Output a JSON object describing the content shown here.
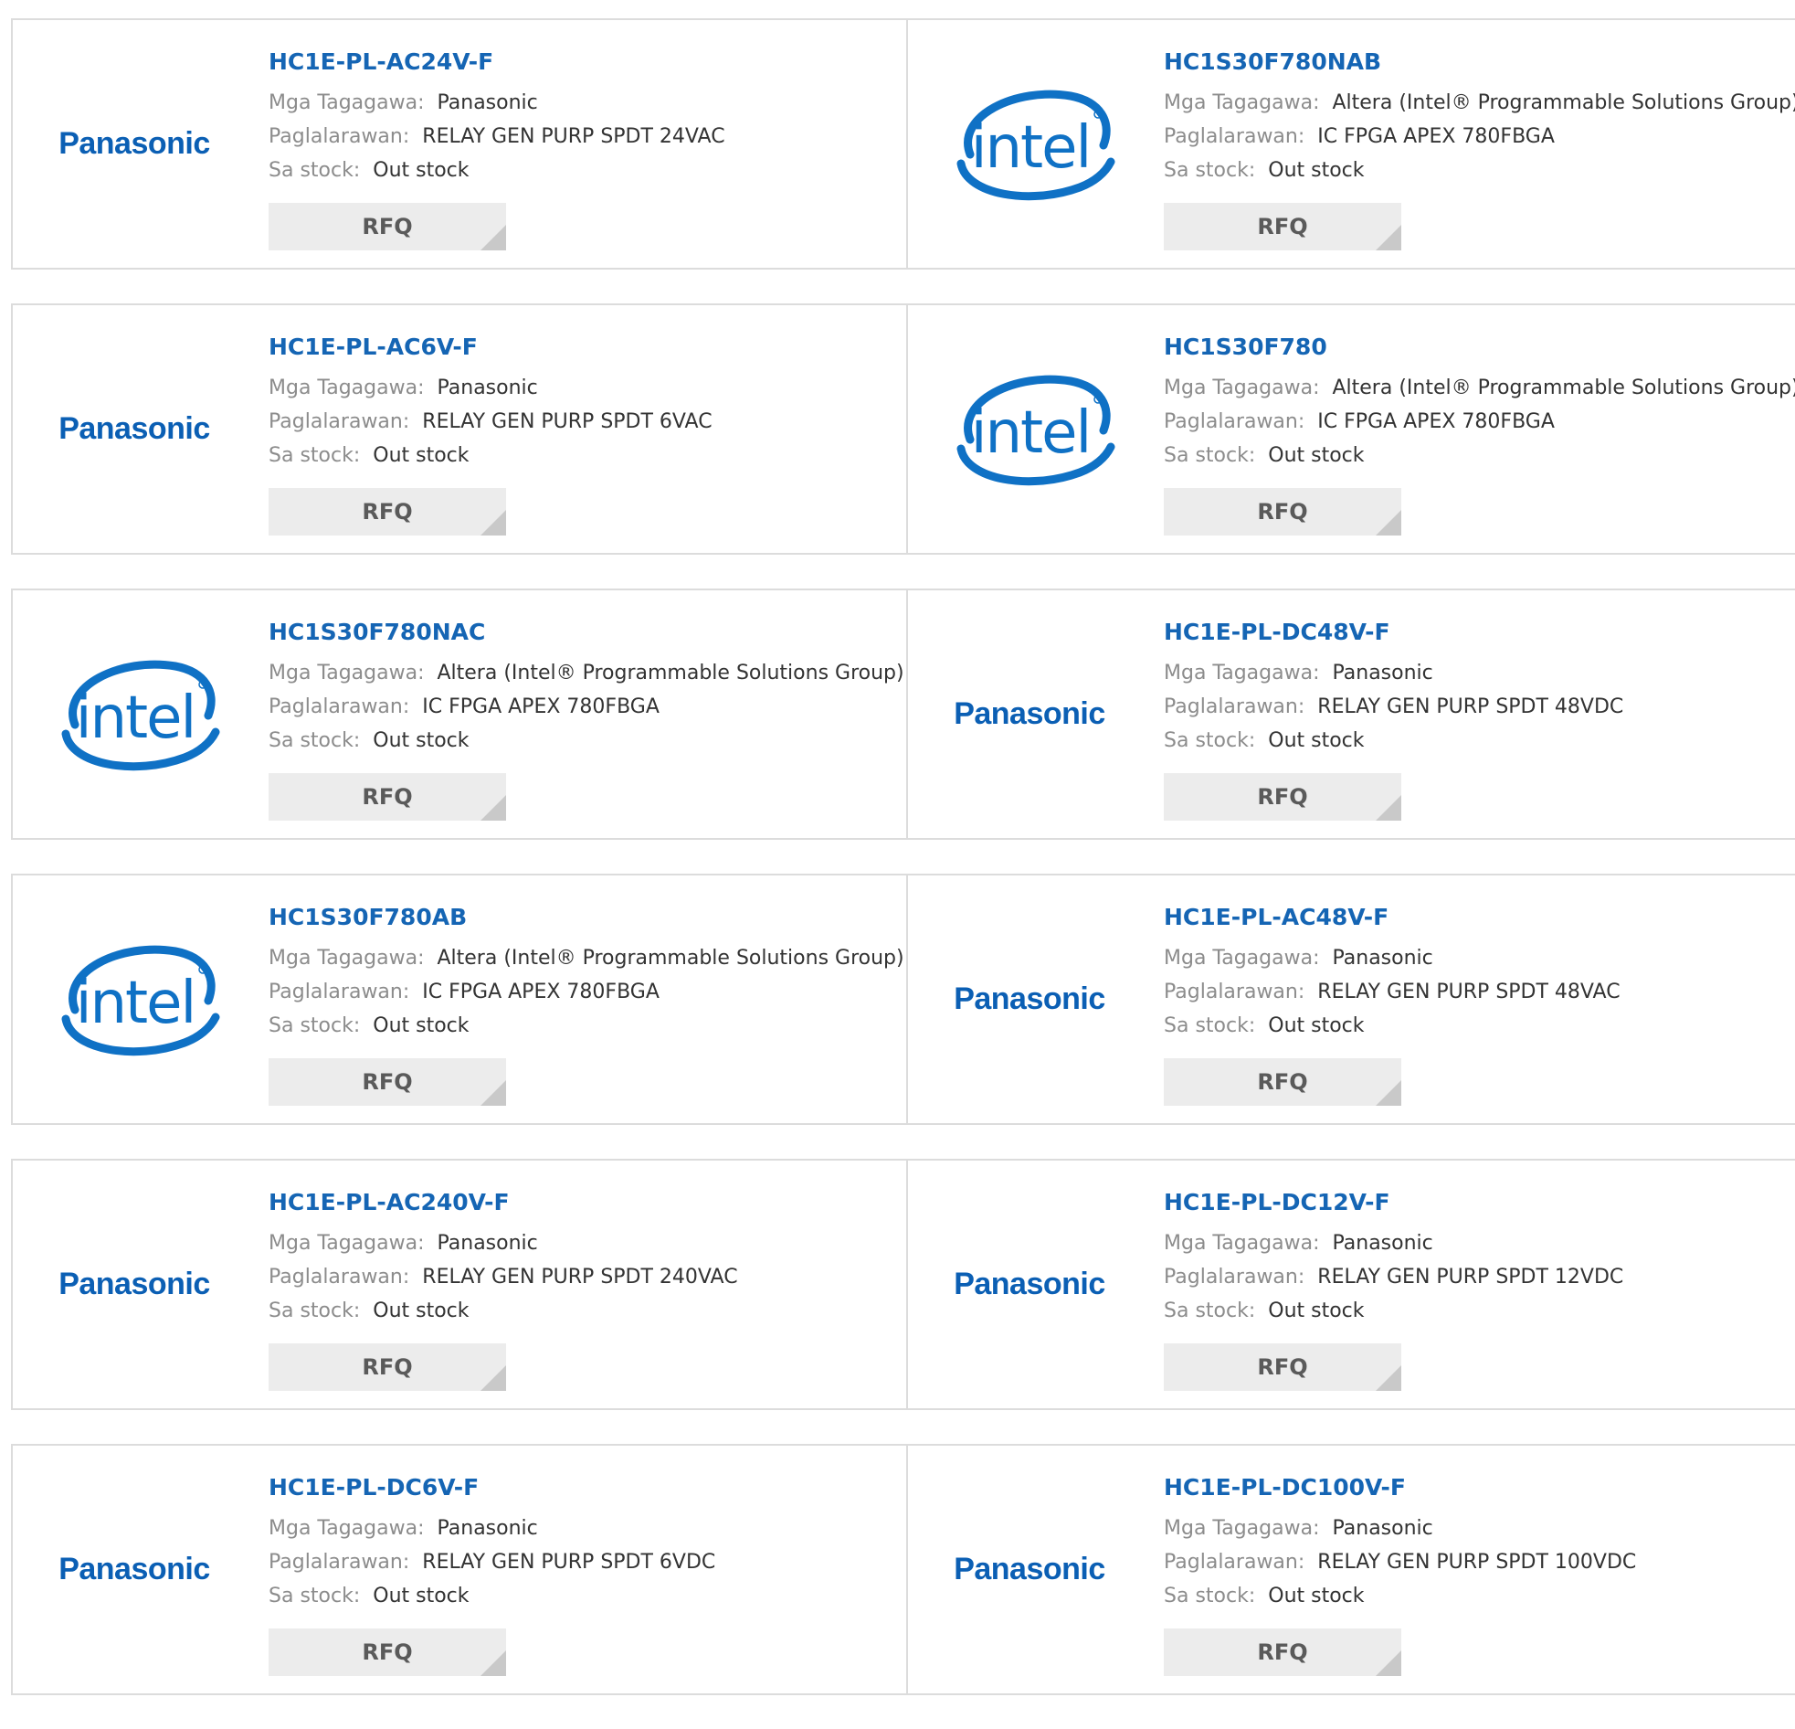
{
  "labels": {
    "manufacturer": "Mga Tagagawa:",
    "description": "Paglalarawan:",
    "stock": "Sa stock:",
    "rfq": "RFQ"
  },
  "brand_colors": {
    "panasonic": "#0b5fb4",
    "intel": "#0f71c5",
    "link": "#1565b4"
  },
  "logos": {
    "panasonic": {
      "text": "Panasonic",
      "icon": "panasonic-logo"
    },
    "intel": {
      "text": "intel",
      "icon": "intel-logo"
    }
  },
  "products": [
    {
      "part": "HC1E-PL-AC24V-F",
      "logo": "panasonic",
      "manufacturer": "Panasonic",
      "description": "RELAY GEN PURP SPDT 24VAC",
      "stock": "Out stock"
    },
    {
      "part": "HC1S30F780NAB",
      "logo": "intel",
      "manufacturer": "Altera (Intel® Programmable Solutions Group)",
      "description": "IC FPGA APEX 780FBGA",
      "stock": "Out stock"
    },
    {
      "part": "HC1E-PL-AC6V-F",
      "logo": "panasonic",
      "manufacturer": "Panasonic",
      "description": "RELAY GEN PURP SPDT 6VAC",
      "stock": "Out stock"
    },
    {
      "part": "HC1S30F780",
      "logo": "intel",
      "manufacturer": "Altera (Intel® Programmable Solutions Group)",
      "description": "IC FPGA APEX 780FBGA",
      "stock": "Out stock"
    },
    {
      "part": "HC1S30F780NAC",
      "logo": "intel",
      "manufacturer": "Altera (Intel® Programmable Solutions Group)",
      "description": "IC FPGA APEX 780FBGA",
      "stock": "Out stock"
    },
    {
      "part": "HC1E-PL-DC48V-F",
      "logo": "panasonic",
      "manufacturer": "Panasonic",
      "description": "RELAY GEN PURP SPDT 48VDC",
      "stock": "Out stock"
    },
    {
      "part": "HC1S30F780AB",
      "logo": "intel",
      "manufacturer": "Altera (Intel® Programmable Solutions Group)",
      "description": "IC FPGA APEX 780FBGA",
      "stock": "Out stock"
    },
    {
      "part": "HC1E-PL-AC48V-F",
      "logo": "panasonic",
      "manufacturer": "Panasonic",
      "description": "RELAY GEN PURP SPDT 48VAC",
      "stock": "Out stock"
    },
    {
      "part": "HC1E-PL-AC240V-F",
      "logo": "panasonic",
      "manufacturer": "Panasonic",
      "description": "RELAY GEN PURP SPDT 240VAC",
      "stock": "Out stock"
    },
    {
      "part": "HC1E-PL-DC12V-F",
      "logo": "panasonic",
      "manufacturer": "Panasonic",
      "description": "RELAY GEN PURP SPDT 12VDC",
      "stock": "Out stock"
    },
    {
      "part": "HC1E-PL-DC6V-F",
      "logo": "panasonic",
      "manufacturer": "Panasonic",
      "description": "RELAY GEN PURP SPDT 6VDC",
      "stock": "Out stock"
    },
    {
      "part": "HC1E-PL-DC100V-F",
      "logo": "panasonic",
      "manufacturer": "Panasonic",
      "description": "RELAY GEN PURP SPDT 100VDC",
      "stock": "Out stock"
    }
  ]
}
